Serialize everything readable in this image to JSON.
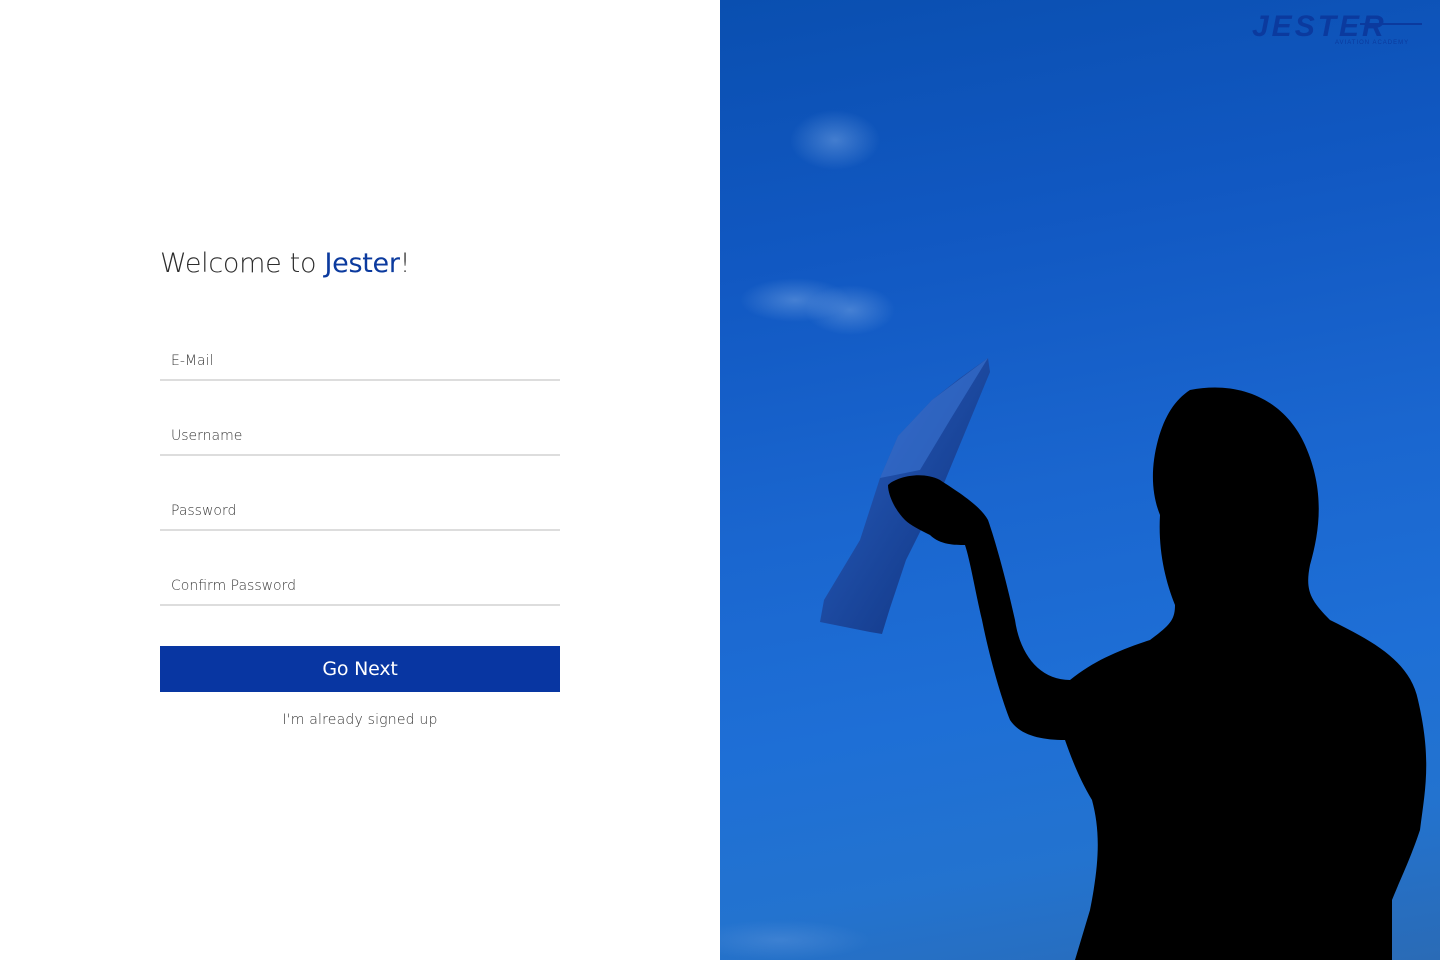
{
  "form": {
    "welcome_prefix": "Welcome to ",
    "welcome_brand": "Jester",
    "welcome_suffix": "!",
    "fields": [
      {
        "placeholder": "E-Mail",
        "value": ""
      },
      {
        "placeholder": "Username",
        "value": ""
      },
      {
        "placeholder": "Password",
        "value": ""
      },
      {
        "placeholder": "Confirm Password",
        "value": ""
      }
    ],
    "submit_label": "Go Next",
    "signin_link": "I'm already signed up"
  },
  "logo": {
    "text": "JESTER",
    "tagline": "AVIATION ACADEMY"
  },
  "hero": {
    "description_icon": "child-with-paper-plane-silhouette"
  },
  "colors": {
    "brand": "#0b3a9e",
    "button": "#0836a2",
    "sky_top": "#0a4fb0",
    "sky_bottom": "#2373cf",
    "silhouette": "#000000"
  }
}
